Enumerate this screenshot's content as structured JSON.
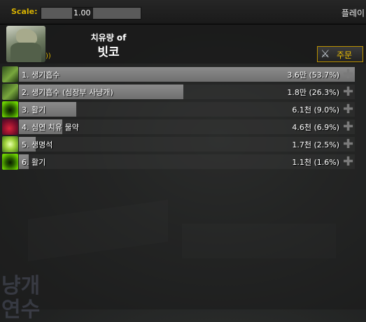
{
  "topbar": {
    "scale_label": "Scale:",
    "scale_value": "1.00",
    "player_label": "플레이"
  },
  "header": {
    "subtitle": "치유량 of",
    "name": "빗코",
    "order_button_label": "주문"
  },
  "rows": [
    {
      "label": "1. 생기흡수",
      "value": "3.6만 (53.7%)",
      "fraction": 1.0,
      "icon": "drain-life-icon"
    },
    {
      "label": "2. 생기흡수 (심장부 사냥개)",
      "value": "1.8만 (26.3%)",
      "fraction": 0.49,
      "icon": "drain-life-icon"
    },
    {
      "label": "3. 활기",
      "value": "6.1천 (9.0%)",
      "fraction": 0.17,
      "icon": "vigor-icon"
    },
    {
      "label": "4. 심연 치유 물약",
      "value": "4.6천 (6.9%)",
      "fraction": 0.13,
      "icon": "healing-potion-icon"
    },
    {
      "label": "5. 생명석",
      "value": "1.7천 (2.5%)",
      "fraction": 0.05,
      "icon": "healthstone-icon"
    },
    {
      "label": "6. 활기",
      "value": "1.1천 (1.6%)",
      "fraction": 0.03,
      "icon": "vigor-icon"
    }
  ],
  "background_text": "냥개\n연수",
  "colors": {
    "accent": "#d8b200",
    "bar": "#808080"
  }
}
